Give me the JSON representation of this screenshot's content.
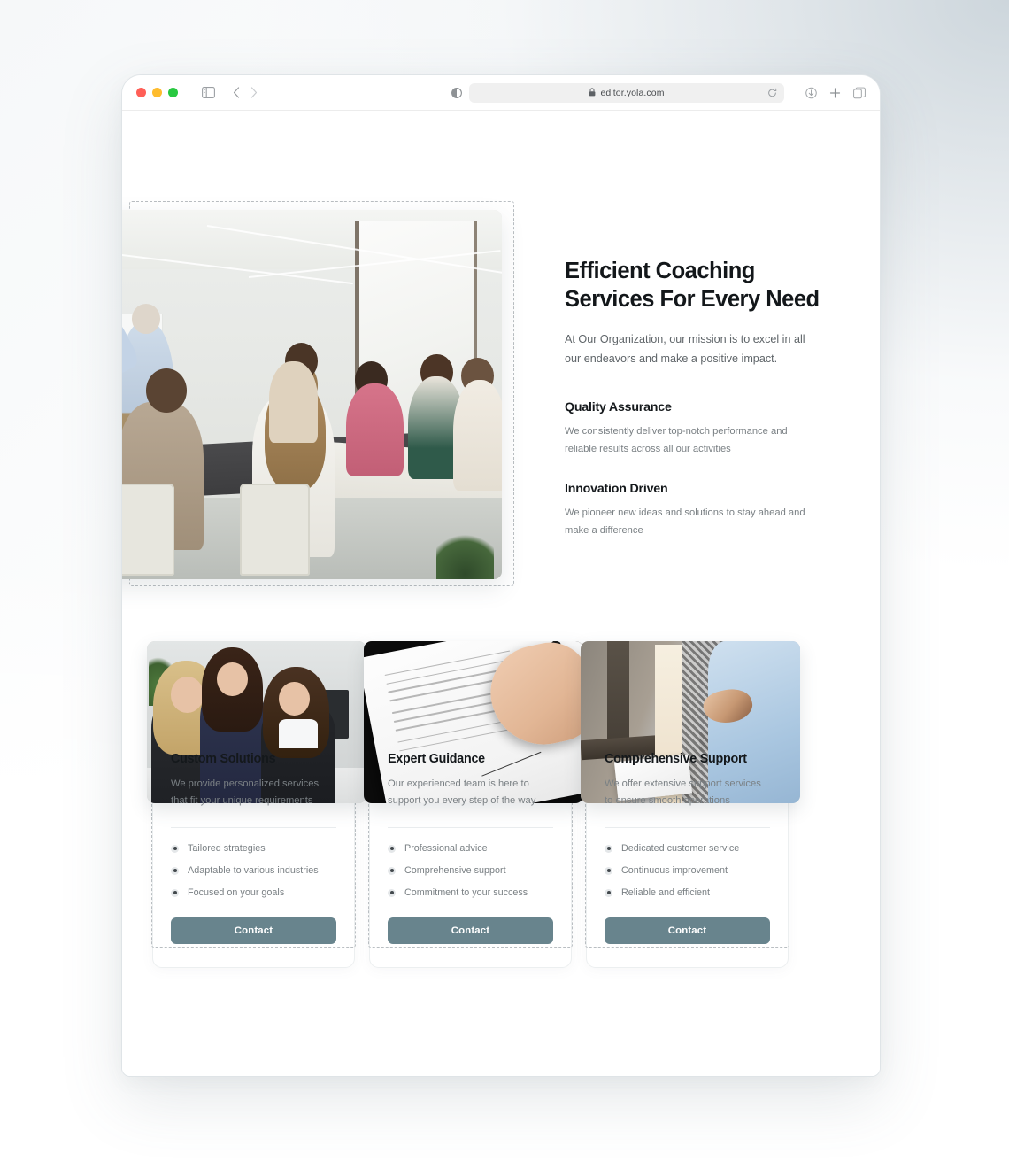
{
  "browser": {
    "url": "editor.yola.com",
    "lock_icon": "lock-icon",
    "reload_icon": "reload-icon",
    "sidebar_icon": "sidebar-toggle-icon",
    "back_icon": "chevron-left-icon",
    "forward_icon": "chevron-right-icon",
    "reader_icon": "reader-mode-icon",
    "download_icon": "download-icon",
    "newtab_icon": "plus-icon",
    "tabs_icon": "tab-overview-icon",
    "traffic_lights": [
      "close-button",
      "minimize-button",
      "maximize-button"
    ]
  },
  "colors": {
    "accent": "#68848d",
    "heading": "#13171a",
    "body_text": "#7a8084",
    "dashed_outline": "#b9bec2",
    "page_bg_tint": "#cdd6dc"
  },
  "hero": {
    "title": "Efficient Coaching Services For Every Need",
    "subtitle": "At Our Organization, our mission is to excel in all our endeavors and make a positive impact.",
    "image_alt": "meeting-room-photo",
    "features": [
      {
        "title": "Quality Assurance",
        "text": "We consistently deliver top-notch performance and reliable results across all our activities"
      },
      {
        "title": "Innovation Driven",
        "text": "We pioneer new ideas and solutions to stay ahead and make a difference"
      }
    ]
  },
  "cards": [
    {
      "title": "Custom Solutions",
      "text": "We provide personalized services that fit your unique requirements",
      "bullets": [
        "Tailored strategies",
        "Adaptable to various industries",
        "Focused on your goals"
      ],
      "button_label": "Contact",
      "image_alt": "three-women-at-desk-photo"
    },
    {
      "title": "Expert Guidance",
      "text": "Our experienced team is here to support you every step of the way",
      "bullets": [
        "Professional advice",
        "Comprehensive support",
        "Commitment to your success"
      ],
      "button_label": "Contact",
      "image_alt": "signing-document-photo"
    },
    {
      "title": "Comprehensive Support",
      "text": "We offer extensive support services to ensure smooth operations",
      "bullets": [
        "Dedicated customer service",
        "Continuous improvement",
        "Reliable and efficient"
      ],
      "button_label": "Contact",
      "image_alt": "handshake-photo"
    }
  ]
}
